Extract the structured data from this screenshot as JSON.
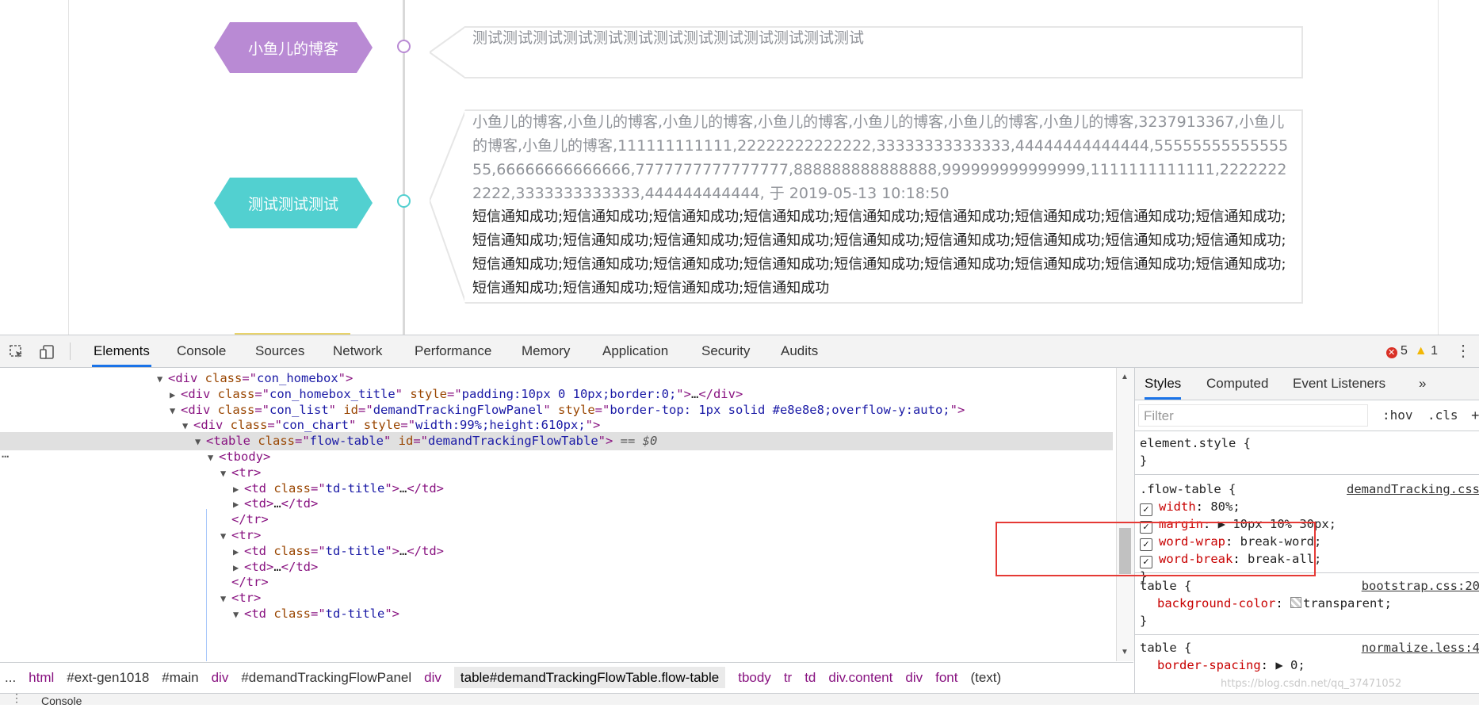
{
  "page": {
    "events": [
      {
        "title": "小鱼儿的博客",
        "color": "#b98ad4",
        "text": "测试测试测试测试测试测试测试测试测试测试测试测试测试"
      },
      {
        "title": "测试测试测试",
        "color": "#52d0d0",
        "gray_text": "小鱼儿的博客,小鱼儿的博客,小鱼儿的博客,小鱼儿的博客,小鱼儿的博客,小鱼儿的博客,小鱼儿的博客,3237913367,小鱼儿的博客,小鱼儿的博客,111111111111,22222222222222,33333333333333,44444444444444,5555555555555555,66666666666666,7777777777777777,888888888888888,999999999999999,1111111111111,22222222222,3333333333333,444444444444, 于 2019-05-13 10:18:50",
        "black_text": "短信通知成功;短信通知成功;短信通知成功;短信通知成功;短信通知成功;短信通知成功;短信通知成功;短信通知成功;短信通知成功;短信通知成功;短信通知成功;短信通知成功;短信通知成功;短信通知成功;短信通知成功;短信通知成功;短信通知成功;短信通知成功;短信通知成功;短信通知成功;短信通知成功;短信通知成功;短信通知成功;短信通知成功;短信通知成功;短信通知成功;短信通知成功;短信通知成功;短信通知成功;短信通知成功;短信通知成功"
      }
    ]
  },
  "devtools": {
    "tabs": [
      "Elements",
      "Console",
      "Sources",
      "Network",
      "Performance",
      "Memory",
      "Application",
      "Security",
      "Audits"
    ],
    "active_tab": "Elements",
    "errors": "5",
    "warnings": "1",
    "dom_lines": [
      {
        "indent": 0,
        "tri": "▼",
        "html": [
          [
            "tag",
            "<div "
          ],
          [
            "an",
            "class"
          ],
          [
            "tag",
            "=\""
          ],
          [
            "av",
            "con_homebox"
          ],
          [
            "tag",
            "\">"
          ]
        ]
      },
      {
        "indent": 1,
        "tri": "▶",
        "html": [
          [
            "tag",
            "<div "
          ],
          [
            "an",
            "class"
          ],
          [
            "tag",
            "=\""
          ],
          [
            "av",
            "con_homebox_title"
          ],
          [
            "tag",
            "\" "
          ],
          [
            "an",
            "style"
          ],
          [
            "tag",
            "=\""
          ],
          [
            "av",
            "padding:10px 0 10px;border:0;"
          ],
          [
            "tag",
            "\">"
          ],
          [
            "tx",
            "…"
          ],
          [
            "tag",
            "</div>"
          ]
        ]
      },
      {
        "indent": 1,
        "tri": "▼",
        "html": [
          [
            "tag",
            "<div "
          ],
          [
            "an",
            "class"
          ],
          [
            "tag",
            "=\""
          ],
          [
            "av",
            "con_list"
          ],
          [
            "tag",
            "\" "
          ],
          [
            "an",
            "id"
          ],
          [
            "tag",
            "=\""
          ],
          [
            "av",
            "demandTrackingFlowPanel"
          ],
          [
            "tag",
            "\" "
          ],
          [
            "an",
            "style"
          ],
          [
            "tag",
            "=\""
          ],
          [
            "av",
            "border-top: 1px solid #e8e8e8;overflow-y:auto;"
          ],
          [
            "tag",
            "\">"
          ]
        ]
      },
      {
        "indent": 2,
        "tri": "▼",
        "html": [
          [
            "tag",
            "<div "
          ],
          [
            "an",
            "class"
          ],
          [
            "tag",
            "=\""
          ],
          [
            "av",
            "con_chart"
          ],
          [
            "tag",
            "\" "
          ],
          [
            "an",
            "style"
          ],
          [
            "tag",
            "=\""
          ],
          [
            "av",
            "width:99%;height:610px;"
          ],
          [
            "tag",
            "\">"
          ]
        ]
      },
      {
        "indent": 3,
        "tri": "▼",
        "selected": true,
        "html": [
          [
            "tag",
            "<table "
          ],
          [
            "an",
            "class"
          ],
          [
            "tag",
            "=\""
          ],
          [
            "av",
            "flow-table"
          ],
          [
            "tag",
            "\" "
          ],
          [
            "an",
            "id"
          ],
          [
            "tag",
            "=\""
          ],
          [
            "av",
            "demandTrackingFlowTable"
          ],
          [
            "tag",
            "\">"
          ],
          [
            "cm",
            " == $0"
          ]
        ]
      },
      {
        "indent": 4,
        "tri": "▼",
        "html": [
          [
            "tag",
            "<tbody>"
          ]
        ]
      },
      {
        "indent": 5,
        "tri": "▼",
        "html": [
          [
            "tag",
            "<tr>"
          ]
        ]
      },
      {
        "indent": 6,
        "tri": "▶",
        "html": [
          [
            "tag",
            "<td "
          ],
          [
            "an",
            "class"
          ],
          [
            "tag",
            "=\""
          ],
          [
            "av",
            "td-title"
          ],
          [
            "tag",
            "\">"
          ],
          [
            "tx",
            "…"
          ],
          [
            "tag",
            "</td>"
          ]
        ]
      },
      {
        "indent": 6,
        "tri": "▶",
        "html": [
          [
            "tag",
            "<td>"
          ],
          [
            "tx",
            "…"
          ],
          [
            "tag",
            "</td>"
          ]
        ]
      },
      {
        "indent": 5,
        "tri": "",
        "html": [
          [
            "tag",
            "</tr>"
          ]
        ]
      },
      {
        "indent": 5,
        "tri": "▼",
        "html": [
          [
            "tag",
            "<tr>"
          ]
        ]
      },
      {
        "indent": 6,
        "tri": "▶",
        "html": [
          [
            "tag",
            "<td "
          ],
          [
            "an",
            "class"
          ],
          [
            "tag",
            "=\""
          ],
          [
            "av",
            "td-title"
          ],
          [
            "tag",
            "\">"
          ],
          [
            "tx",
            "…"
          ],
          [
            "tag",
            "</td>"
          ]
        ]
      },
      {
        "indent": 6,
        "tri": "▶",
        "html": [
          [
            "tag",
            "<td>"
          ],
          [
            "tx",
            "…"
          ],
          [
            "tag",
            "</td>"
          ]
        ]
      },
      {
        "indent": 5,
        "tri": "",
        "html": [
          [
            "tag",
            "</tr>"
          ]
        ]
      },
      {
        "indent": 5,
        "tri": "▼",
        "html": [
          [
            "tag",
            "<tr>"
          ]
        ]
      },
      {
        "indent": 6,
        "tri": "▼",
        "html": [
          [
            "tag",
            "<td "
          ],
          [
            "an",
            "class"
          ],
          [
            "tag",
            "=\""
          ],
          [
            "av",
            "td-title"
          ],
          [
            "tag",
            "\">"
          ]
        ]
      }
    ],
    "breadcrumbs": [
      {
        "text": "...",
        "kind": "i"
      },
      {
        "text": "html",
        "kind": "t"
      },
      {
        "text": "#ext-gen1018",
        "kind": "i"
      },
      {
        "text": "#main",
        "kind": "i"
      },
      {
        "text": "div",
        "kind": "t"
      },
      {
        "text": "#demandTrackingFlowPanel",
        "kind": "i"
      },
      {
        "text": "div",
        "kind": "t"
      },
      {
        "text": "table#demandTrackingFlowTable.flow-table",
        "kind": "act"
      },
      {
        "text": "tbody",
        "kind": "t"
      },
      {
        "text": "tr",
        "kind": "t"
      },
      {
        "text": "td",
        "kind": "t"
      },
      {
        "text": "div.content",
        "kind": "t"
      },
      {
        "text": "div",
        "kind": "t"
      },
      {
        "text": "font",
        "kind": "t"
      },
      {
        "text": "(text)",
        "kind": "i"
      }
    ],
    "styles_tabs": [
      "Styles",
      "Computed",
      "Event Listeners",
      "»"
    ],
    "filter_placeholder": "Filter",
    "hov": ":hov",
    "cls": ".cls",
    "plus": "+",
    "rules": {
      "element_style": {
        "selector": "element.style {",
        "close": "}"
      },
      "flow_table": {
        "selector": ".flow-table {",
        "source": "demandTracking.css",
        "props": [
          {
            "name": "width",
            "value": "80%;"
          },
          {
            "name": "margin",
            "value": "▶ 10px 10% 30px;"
          },
          {
            "name": "word-wrap",
            "value": "break-word;"
          },
          {
            "name": "word-break",
            "value": "break-all;"
          }
        ],
        "close": "}"
      },
      "table_bootstrap": {
        "selector": "table {",
        "source": "bootstrap.css:20",
        "prop_name": "background-color",
        "prop_value": "transparent;",
        "close": "}"
      },
      "table_normalize": {
        "selector": "table {",
        "source": "normalize.less:4",
        "prop_name": "border-spacing",
        "prop_value": "▶ 0;"
      }
    },
    "console_label": "Console",
    "watermark": "https://blog.csdn.net/qq_37471052"
  }
}
